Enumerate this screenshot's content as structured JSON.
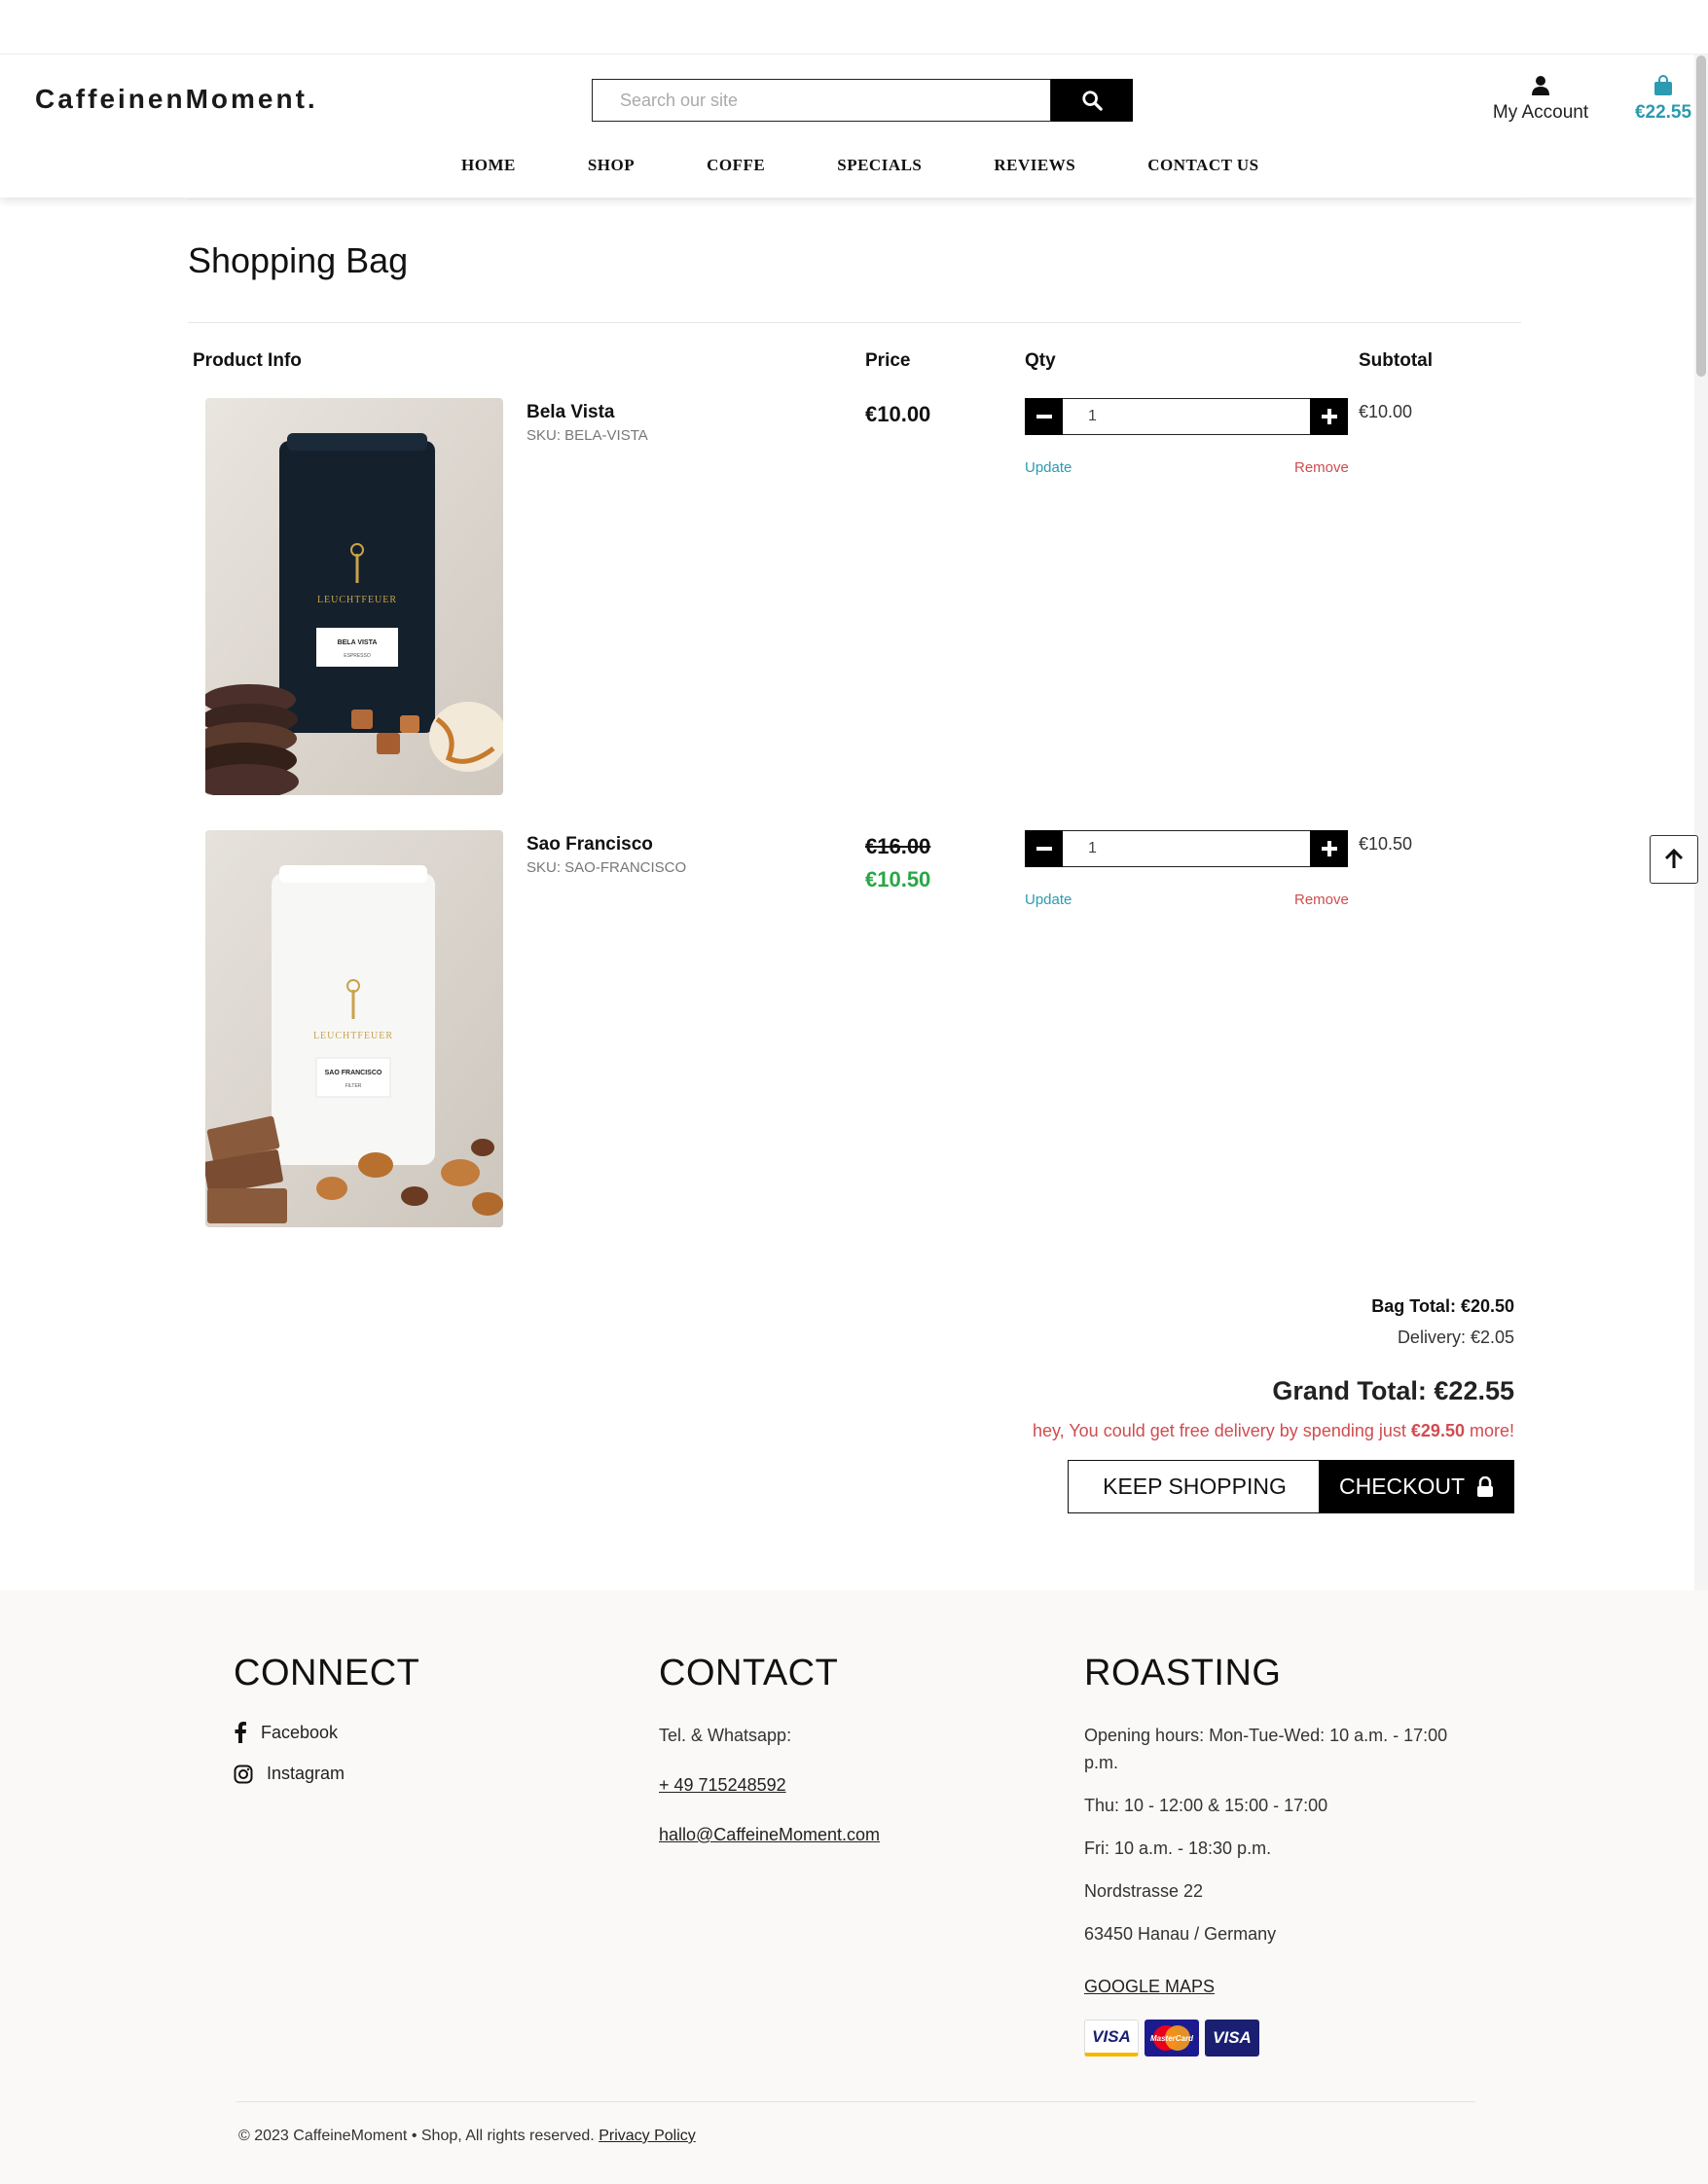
{
  "header": {
    "logo": "CaffeinenMoment.",
    "search_placeholder": "Search our site",
    "account_label": "My Account",
    "cart_total": "€22.55",
    "nav": [
      "HOME",
      "SHOP",
      "COFFE",
      "SPECIALS",
      "REVIEWS",
      "CONTACT US"
    ]
  },
  "bag": {
    "title": "Shopping Bag",
    "columns": {
      "product": "Product Info",
      "price": "Price",
      "qty": "Qty",
      "subtotal": "Subtotal"
    },
    "items": [
      {
        "name": "Bela Vista",
        "sku": "SKU: BELA-VISTA",
        "price": "€10.00",
        "qty": "1",
        "subtotal": "€10.00",
        "update_label": "Update",
        "remove_label": "Remove",
        "bag_color": "#14202c",
        "pack_brand": "LEUCHTFEUER",
        "pack_label": "BELA VISTA",
        "pack_sub": "ESPRESSO"
      },
      {
        "name": "Sao Francisco",
        "sku": "SKU: SAO-FRANCISCO",
        "old_price": "€16.00",
        "price": "€10.50",
        "qty": "1",
        "subtotal": "€10.50",
        "update_label": "Update",
        "remove_label": "Remove",
        "bag_color": "#f7f7f5",
        "pack_brand": "LEUCHTFEUER",
        "pack_label": "SAO FRANCISCO",
        "pack_sub": "FILTER"
      }
    ],
    "bag_total": "Bag Total: €20.50",
    "delivery": "Delivery: €2.05",
    "grand_total": "Grand Total: €22.55",
    "free_note_prefix": "hey, You could get free delivery by spending just",
    "free_note_amount": "€29.50",
    "free_note_suffix": "more!",
    "keep_shopping": "KEEP SHOPPING",
    "checkout": "CHECKOUT"
  },
  "footer": {
    "connect": {
      "title": "CONNECT",
      "facebook": "Facebook",
      "instagram": "Instagram"
    },
    "contact": {
      "title": "CONTACT",
      "tel_label": "Tel. & Whatsapp:",
      "phone": "+ 49 715248592",
      "email": "hallo@CaffeineMoment.com"
    },
    "roasting": {
      "title": "ROASTING",
      "lines": [
        "Opening hours: Mon-Tue-Wed: 10 a.m. - 17:00 p.m.",
        "Thu: 10 - 12:00 & 15:00 - 17:00",
        "Fri: 10 a.m. - 18:30 p.m.",
        "Nordstrasse 22",
        "63450 Hanau / Germany"
      ],
      "maps": "GOOGLE MAPS"
    },
    "cards": [
      "VISA",
      "MasterCard",
      "VISA"
    ],
    "copyright": "© 2023 CaffeineMoment • Shop, All rights reserved.",
    "privacy": "Privacy Policy"
  },
  "colors": {
    "accent": "#2a9bb0",
    "danger": "#d04c50",
    "sale": "#28a745"
  }
}
